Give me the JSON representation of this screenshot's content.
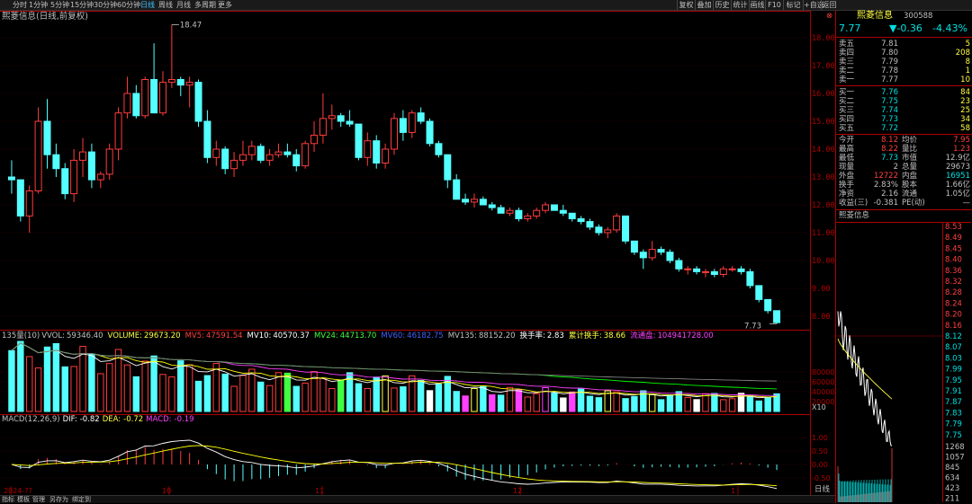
{
  "periods": [
    "分时",
    "1分钟",
    "5分钟",
    "15分钟",
    "30分钟",
    "60分钟",
    "日线",
    "周线",
    "月线",
    "多周期",
    "更多"
  ],
  "active_period": "日线",
  "toolbar": [
    "复权",
    "叠加",
    "历史",
    "统计",
    "画线",
    "F10",
    "标记",
    "+自选",
    "返回"
  ],
  "chart_title": "熙菱信息(日线,前复权)",
  "price_axis": [
    "18.00",
    "17.00",
    "16.00",
    "15.00",
    "14.00",
    "13.00",
    "12.00",
    "11.00",
    "10.00",
    "9.00",
    "8.00"
  ],
  "high_label": "18.47",
  "low_label": "7.73",
  "vol_line": {
    "name": "135量(10)",
    "vvol_label": "VVOL:",
    "vvol": "59346.40",
    "volume_label": "VOLUME:",
    "volume": "29673.20",
    "mv5_label": "MV5:",
    "mv5": "47591.54",
    "mv10_label": "MV10:",
    "mv10": "40570.37",
    "mv24_label": "MV24:",
    "mv24": "44713.70",
    "mv60_label": "MV60:",
    "mv60": "46182.75",
    "mv135_label": "MV135:",
    "mv135": "88152.20",
    "turnover_label": "换手率:",
    "turnover": "2.83",
    "cum_label": "累计换手:",
    "cum": "38.66",
    "float_label": "流通盘:",
    "float": "104941728.00"
  },
  "vol_axis": [
    "80000",
    "60000",
    "40000",
    "20000",
    "X10"
  ],
  "macd_line": {
    "name": "MACD(12,26,9)",
    "dif_label": "DIF:",
    "dif": "-0.82",
    "dea_label": "DEA:",
    "dea": "-0.72",
    "macd_label": "MACD:",
    "macd": "-0.19"
  },
  "macd_axis": [
    "1.00",
    "0.50",
    "0.00",
    "-0.50"
  ],
  "date_axis": [
    "2024-??",
    "10",
    "11",
    "12",
    "1"
  ],
  "bottom_tabs": [
    "指标",
    "模板",
    "管理",
    "另存为",
    "绑定到"
  ],
  "bottom_right": "日线",
  "quote": {
    "name": "熙菱信息",
    "code": "300588",
    "price": "7.77",
    "change": "▼-0.36",
    "change_pct": "-4.43%",
    "asks": [
      {
        "label": "卖五",
        "price": "7.81",
        "vol": "5"
      },
      {
        "label": "卖四",
        "price": "7.80",
        "vol": "208"
      },
      {
        "label": "卖三",
        "price": "7.79",
        "vol": "8"
      },
      {
        "label": "卖二",
        "price": "7.78",
        "vol": "1"
      },
      {
        "label": "卖一",
        "price": "7.77",
        "vol": "10"
      }
    ],
    "bids": [
      {
        "label": "买一",
        "price": "7.76",
        "vol": "84"
      },
      {
        "label": "买二",
        "price": "7.75",
        "vol": "23"
      },
      {
        "label": "买三",
        "price": "7.74",
        "vol": "25"
      },
      {
        "label": "买四",
        "price": "7.73",
        "vol": "34"
      },
      {
        "label": "买五",
        "price": "7.72",
        "vol": "58"
      }
    ],
    "stats": [
      [
        {
          "l": "今开",
          "v": "8.12",
          "c": "#ff4040"
        },
        {
          "l": "均价",
          "v": "7.95",
          "c": "#ff4040"
        }
      ],
      [
        {
          "l": "最高",
          "v": "8.22",
          "c": "#ff4040"
        },
        {
          "l": "量比",
          "v": "1.23",
          "c": "#ff4040"
        }
      ],
      [
        {
          "l": "最低",
          "v": "7.73",
          "c": "#00e0e0"
        },
        {
          "l": "市值",
          "v": "12.9亿",
          "c": "#c0c0c0"
        }
      ],
      [
        {
          "l": "现量",
          "v": "2",
          "c": "#c0c0c0"
        },
        {
          "l": "总量",
          "v": "29673",
          "c": "#c0c0c0"
        }
      ],
      [
        {
          "l": "外盘",
          "v": "12722",
          "c": "#ff4040"
        },
        {
          "l": "内盘",
          "v": "16951",
          "c": "#00e0e0"
        }
      ],
      [
        {
          "l": "换手",
          "v": "2.83%",
          "c": "#c0c0c0"
        },
        {
          "l": "股本",
          "v": "1.66亿",
          "c": "#c0c0c0"
        }
      ],
      [
        {
          "l": "净资",
          "v": "2.16",
          "c": "#c0c0c0"
        },
        {
          "l": "流通",
          "v": "1.05亿",
          "c": "#c0c0c0"
        }
      ]
    ],
    "income_label": "收益(三)",
    "income": "-0.381",
    "pe": "PE(动)",
    "pe_val": "—"
  },
  "mini": {
    "title": "熙菱信息",
    "price_axis": [
      "8.53",
      "8.49",
      "8.45",
      "8.40",
      "8.36",
      "8.32",
      "8.28",
      "8.24",
      "8.20",
      "8.16",
      "8.12",
      "8.07",
      "8.03",
      "7.99",
      "7.95",
      "7.91",
      "7.87",
      "7.83",
      "7.79",
      "7.75"
    ],
    "vol_axis": [
      "1268",
      "1057",
      "845",
      "634",
      "423",
      "211"
    ]
  },
  "colors": {
    "up": "#ff3c3c",
    "down": "#54ffff",
    "bg": "#000000",
    "grid": "#5a0000"
  },
  "chart_data": {
    "type": "candlestick",
    "note": "daily OHLC candles, front-adjusted",
    "candles": [
      [
        13.0,
        13.6,
        12.4,
        12.9
      ],
      [
        12.9,
        12.9,
        11.4,
        11.6
      ],
      [
        11.6,
        12.7,
        11.0,
        12.5
      ],
      [
        12.5,
        15.5,
        12.4,
        15.0
      ],
      [
        15.0,
        15.8,
        13.3,
        13.8
      ],
      [
        13.8,
        14.2,
        13.0,
        13.3
      ],
      [
        13.3,
        13.5,
        12.2,
        12.4
      ],
      [
        12.4,
        14.0,
        12.1,
        13.6
      ],
      [
        13.6,
        14.4,
        13.0,
        13.9
      ],
      [
        13.9,
        14.2,
        12.6,
        12.9
      ],
      [
        12.9,
        13.2,
        12.6,
        13.1
      ],
      [
        13.1,
        14.2,
        12.9,
        14.0
      ],
      [
        14.0,
        15.5,
        13.6,
        15.3
      ],
      [
        15.3,
        16.6,
        15.1,
        16.0
      ],
      [
        16.0,
        16.3,
        15.1,
        15.2
      ],
      [
        15.2,
        16.6,
        15.1,
        16.5
      ],
      [
        16.5,
        17.8,
        16.2,
        15.3
      ],
      [
        15.3,
        16.8,
        15.2,
        16.4
      ],
      [
        16.4,
        18.47,
        16.2,
        16.5
      ],
      [
        16.5,
        16.6,
        15.9,
        16.3
      ],
      [
        16.3,
        16.6,
        15.5,
        16.4
      ],
      [
        16.4,
        16.5,
        14.8,
        15.0
      ],
      [
        15.0,
        15.4,
        13.5,
        13.7
      ],
      [
        13.7,
        14.3,
        13.4,
        14.0
      ],
      [
        14.0,
        14.1,
        13.1,
        13.3
      ],
      [
        13.3,
        13.9,
        13.0,
        13.6
      ],
      [
        13.6,
        14.3,
        13.4,
        13.8
      ],
      [
        13.8,
        14.3,
        13.6,
        14.1
      ],
      [
        14.1,
        14.2,
        13.5,
        13.6
      ],
      [
        13.6,
        14.0,
        13.4,
        13.8
      ],
      [
        13.8,
        14.2,
        13.7,
        13.9
      ],
      [
        13.9,
        14.2,
        13.7,
        13.8
      ],
      [
        13.8,
        14.0,
        13.2,
        13.4
      ],
      [
        13.4,
        14.3,
        13.3,
        14.2
      ],
      [
        14.2,
        15.0,
        13.9,
        14.5
      ],
      [
        14.5,
        16.0,
        14.2,
        15.1
      ],
      [
        15.1,
        15.6,
        14.7,
        15.2
      ],
      [
        15.2,
        15.3,
        14.8,
        15.0
      ],
      [
        15.0,
        15.4,
        14.8,
        14.9
      ],
      [
        14.9,
        14.9,
        13.6,
        13.7
      ],
      [
        13.7,
        14.6,
        13.4,
        14.3
      ],
      [
        14.3,
        14.5,
        13.3,
        13.5
      ],
      [
        13.5,
        14.2,
        13.3,
        14.0
      ],
      [
        14.0,
        15.3,
        13.8,
        15.1
      ],
      [
        15.1,
        15.4,
        14.3,
        14.6
      ],
      [
        14.6,
        15.4,
        14.4,
        15.3
      ],
      [
        15.3,
        15.5,
        14.9,
        15.0
      ],
      [
        15.0,
        15.1,
        14.1,
        14.2
      ],
      [
        14.2,
        14.3,
        13.7,
        13.8
      ],
      [
        13.8,
        13.8,
        12.6,
        12.9
      ],
      [
        12.9,
        13.1,
        12.2,
        12.2
      ],
      [
        12.2,
        12.4,
        12.0,
        12.1
      ],
      [
        12.1,
        12.4,
        11.9,
        12.2
      ],
      [
        12.2,
        12.3,
        12.0,
        12.0
      ],
      [
        12.0,
        12.1,
        11.8,
        11.9
      ],
      [
        11.9,
        12.0,
        11.7,
        11.7
      ],
      [
        11.7,
        11.9,
        11.6,
        11.8
      ],
      [
        11.8,
        11.9,
        11.4,
        11.5
      ],
      [
        11.5,
        11.7,
        11.4,
        11.6
      ],
      [
        11.6,
        11.9,
        11.5,
        11.8
      ],
      [
        11.8,
        12.1,
        11.7,
        12.0
      ],
      [
        12.0,
        12.0,
        11.8,
        11.8
      ],
      [
        11.8,
        12.0,
        11.6,
        11.7
      ],
      [
        11.7,
        11.7,
        11.4,
        11.5
      ],
      [
        11.5,
        11.6,
        11.3,
        11.4
      ],
      [
        11.4,
        11.5,
        11.1,
        11.2
      ],
      [
        11.2,
        11.3,
        10.9,
        11.0
      ],
      [
        11.0,
        11.2,
        10.8,
        11.1
      ],
      [
        11.1,
        11.7,
        11.0,
        11.6
      ],
      [
        11.6,
        11.6,
        10.6,
        10.7
      ],
      [
        10.7,
        10.7,
        10.2,
        10.3
      ],
      [
        10.3,
        10.4,
        9.7,
        10.1
      ],
      [
        10.1,
        10.7,
        10.0,
        10.4
      ],
      [
        10.4,
        10.5,
        10.2,
        10.3
      ],
      [
        10.3,
        10.4,
        9.9,
        10.0
      ],
      [
        10.0,
        10.1,
        9.6,
        9.7
      ],
      [
        9.7,
        9.8,
        9.5,
        9.7
      ],
      [
        9.7,
        9.8,
        9.5,
        9.6
      ],
      [
        9.6,
        9.7,
        9.4,
        9.6
      ],
      [
        9.6,
        9.7,
        9.4,
        9.5
      ],
      [
        9.5,
        9.8,
        9.4,
        9.7
      ],
      [
        9.7,
        9.8,
        9.6,
        9.7
      ],
      [
        9.7,
        9.8,
        9.5,
        9.6
      ],
      [
        9.6,
        9.7,
        9.0,
        9.1
      ],
      [
        9.1,
        9.1,
        8.5,
        8.6
      ],
      [
        8.6,
        8.6,
        8.1,
        8.2
      ],
      [
        8.2,
        8.2,
        7.73,
        7.77
      ]
    ],
    "volume_colors": "matches candle direction",
    "macd_hist": "negative bars below zero in later period"
  }
}
